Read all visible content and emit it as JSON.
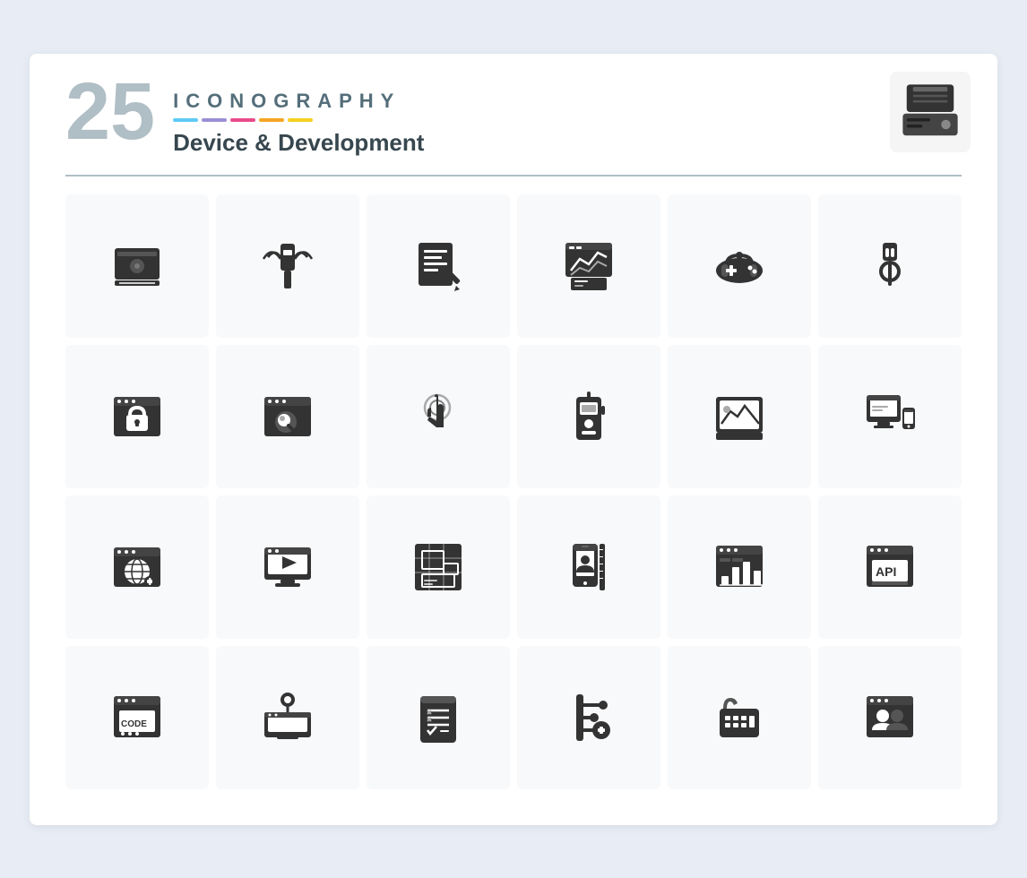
{
  "header": {
    "number": "25",
    "iconography": "ICONOGRAPHY",
    "subtitle": "Device & Development",
    "color_bars": [
      "#5ecbf5",
      "#9b8ed4",
      "#e94b8a",
      "#f5a623",
      "#f5d020"
    ]
  },
  "corner_icon": "printer-icon",
  "grid": {
    "rows": [
      [
        {
          "name": "hard-drive-icon",
          "label": "hard drive"
        },
        {
          "name": "usb-icon",
          "label": "usb"
        },
        {
          "name": "document-edit-icon",
          "label": "document edit"
        },
        {
          "name": "analytics-icon",
          "label": "analytics"
        },
        {
          "name": "gamepad-icon",
          "label": "gamepad"
        },
        {
          "name": "plug-icon",
          "label": "plug"
        }
      ],
      [
        {
          "name": "browser-lock-icon",
          "label": "browser lock"
        },
        {
          "name": "browser-search-icon",
          "label": "browser search"
        },
        {
          "name": "touch-icon",
          "label": "touch"
        },
        {
          "name": "walkie-talkie-icon",
          "label": "walkie talkie"
        },
        {
          "name": "image-frame-icon",
          "label": "image frame"
        },
        {
          "name": "responsive-icon",
          "label": "responsive"
        }
      ],
      [
        {
          "name": "browser-globe-icon",
          "label": "browser globe"
        },
        {
          "name": "monitor-video-icon",
          "label": "monitor video"
        },
        {
          "name": "blueprint-icon",
          "label": "blueprint"
        },
        {
          "name": "mobile-user-icon",
          "label": "mobile user"
        },
        {
          "name": "browser-chart-icon",
          "label": "browser chart"
        },
        {
          "name": "api-icon",
          "label": "api"
        }
      ],
      [
        {
          "name": "code-browser-icon",
          "label": "code browser"
        },
        {
          "name": "map-computer-icon",
          "label": "map computer"
        },
        {
          "name": "scroll-list-icon",
          "label": "scroll list"
        },
        {
          "name": "circuit-plus-icon",
          "label": "circuit plus"
        },
        {
          "name": "telephone-icon",
          "label": "telephone"
        },
        {
          "name": "browser-users-icon",
          "label": "browser users"
        }
      ]
    ]
  }
}
